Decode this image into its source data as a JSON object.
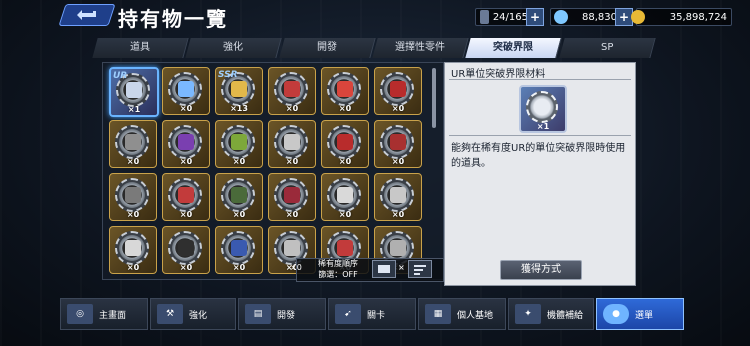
{
  "header": {
    "title": "持有物一覽",
    "capacity": "24/165",
    "currency1": "88,830",
    "currency2": "35,898,724"
  },
  "tabs": [
    {
      "label": "道具",
      "active": false
    },
    {
      "label": "強化",
      "active": false
    },
    {
      "label": "開發",
      "active": false
    },
    {
      "label": "選擇性零件",
      "active": false
    },
    {
      "label": "突破界限",
      "active": true
    },
    {
      "label": "SP",
      "active": false
    }
  ],
  "items": [
    {
      "count": "×1",
      "tag": "UR",
      "color": "#c9d6ea",
      "selected": true
    },
    {
      "count": "×0",
      "tag": "",
      "color": "#7ab8ff"
    },
    {
      "count": "×13",
      "tag": "SSR",
      "color": "#e2b84a"
    },
    {
      "count": "×0",
      "tag": "",
      "color": "#c23b3b"
    },
    {
      "count": "×0",
      "tag": "",
      "color": "#d9453c"
    },
    {
      "count": "×0",
      "tag": "",
      "color": "#b82c2c"
    },
    {
      "count": "×0",
      "tag": "",
      "color": "#8f8f8f"
    },
    {
      "count": "×0",
      "tag": "",
      "color": "#7a3fb0"
    },
    {
      "count": "×0",
      "tag": "",
      "color": "#7da83a"
    },
    {
      "count": "×0",
      "tag": "",
      "color": "#c8c8c8"
    },
    {
      "count": "×0",
      "tag": "",
      "color": "#b82c2c"
    },
    {
      "count": "×0",
      "tag": "",
      "color": "#a83030"
    },
    {
      "count": "×0",
      "tag": "",
      "color": "#7a7a7a"
    },
    {
      "count": "×0",
      "tag": "",
      "color": "#c23b3b"
    },
    {
      "count": "×0",
      "tag": "",
      "color": "#4a6a3a"
    },
    {
      "count": "×0",
      "tag": "",
      "color": "#9a2a3a"
    },
    {
      "count": "×0",
      "tag": "",
      "color": "#d9d9d9"
    },
    {
      "count": "×0",
      "tag": "",
      "color": "#c8c8c8"
    },
    {
      "count": "×0",
      "tag": "",
      "color": "#d8d8d8"
    },
    {
      "count": "×0",
      "tag": "",
      "color": "#2f2f2f"
    },
    {
      "count": "×0",
      "tag": "",
      "color": "#3a5ab0"
    },
    {
      "count": "×0",
      "tag": "",
      "color": "#c0c0c0"
    },
    {
      "count": "×0",
      "tag": "",
      "color": "#c23b3b"
    },
    {
      "count": "×0",
      "tag": "",
      "color": "#b0b0b0"
    }
  ],
  "sort": {
    "count": "×0",
    "line1": "稀有度順序",
    "line2": "篩選：OFF",
    "count2": "×"
  },
  "detail": {
    "title": "UR單位突破界限材料",
    "count": "×1",
    "description": "能夠在稀有度UR的單位突破界限時使用的道具。",
    "obtain_button": "獲得方式"
  },
  "nav": [
    {
      "label": "主畫面",
      "icon": "home-icon",
      "active": false
    },
    {
      "label": "強化",
      "icon": "wrench-icon",
      "active": false
    },
    {
      "label": "開發",
      "icon": "factory-icon",
      "active": false
    },
    {
      "label": "關卡",
      "icon": "rifle-icon",
      "active": false
    },
    {
      "label": "個人基地",
      "icon": "base-icon",
      "active": false
    },
    {
      "label": "機體補給",
      "icon": "supply-icon",
      "active": false
    },
    {
      "label": "選單",
      "icon": "menu-icon",
      "active": true
    }
  ]
}
